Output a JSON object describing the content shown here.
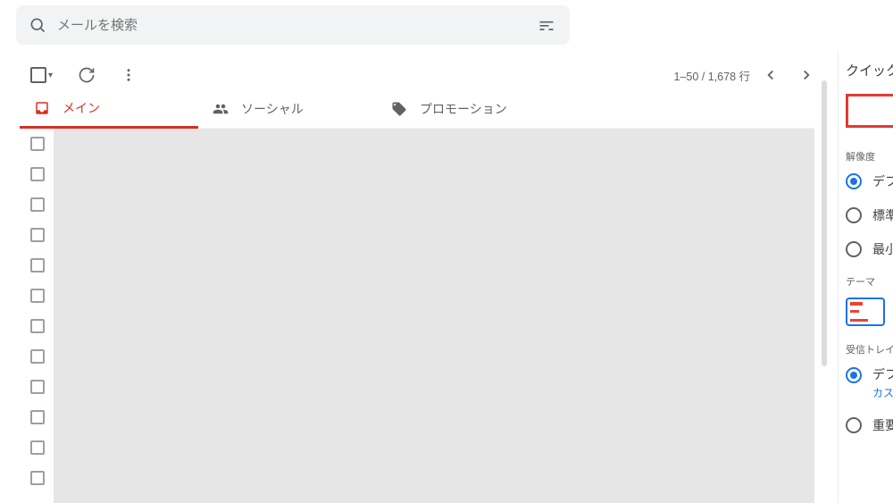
{
  "search": {
    "placeholder": "メールを検索"
  },
  "toolbar": {
    "pager_text": "1–50 / 1,678 行"
  },
  "tabs": [
    {
      "key": "primary",
      "label": "メイン",
      "active": true
    },
    {
      "key": "social",
      "label": "ソーシャル",
      "active": false
    },
    {
      "key": "promotions",
      "label": "プロモーション",
      "active": false
    }
  ],
  "list": {
    "row_count": 12
  },
  "panel": {
    "title": "クイック",
    "sections": {
      "resolution": {
        "label": "解像度",
        "options": [
          {
            "label": "デフ",
            "checked": true
          },
          {
            "label": "標準",
            "checked": false
          },
          {
            "label": "最小",
            "checked": false
          }
        ]
      },
      "theme": {
        "label": "テーマ"
      },
      "inbox": {
        "label": "受信トレイ",
        "options": [
          {
            "label": "デフ",
            "sublabel": "カス",
            "checked": true
          },
          {
            "label": "重要",
            "checked": false
          }
        ]
      }
    }
  }
}
